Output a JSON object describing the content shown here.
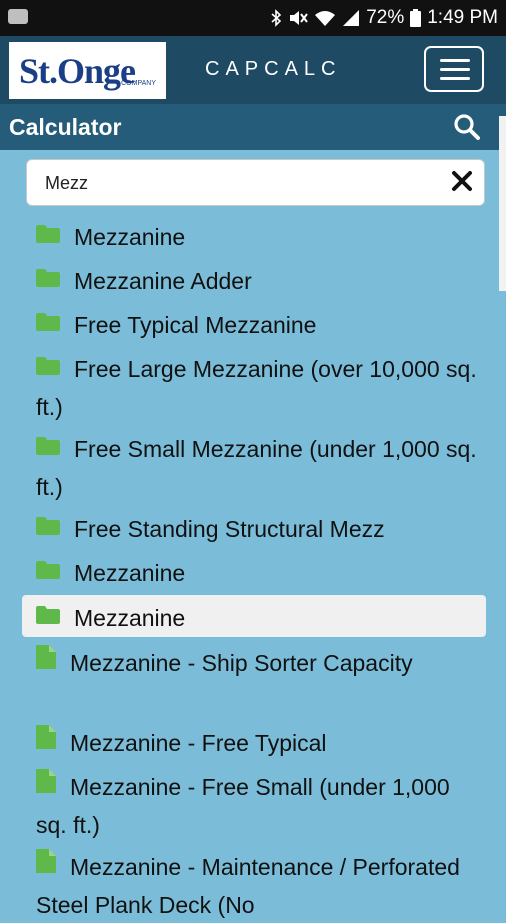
{
  "status_bar": {
    "battery": "72%",
    "time": "1:49 PM"
  },
  "header": {
    "logo_text": "St.Onge",
    "logo_small": "COMPANY",
    "title": "CAPCALC"
  },
  "subheader": {
    "title": "Calculator"
  },
  "search": {
    "value": "Mezz"
  },
  "results": [
    {
      "label": "Mezzanine",
      "icon": "folder-icon"
    },
    {
      "label": "Mezzanine Adder",
      "icon": "folder-icon"
    },
    {
      "label": "Free Typical Mezzanine",
      "icon": "folder-icon"
    },
    {
      "label": "Free Large Mezzanine (over 10,000 sq. ft.)",
      "icon": "folder-icon"
    },
    {
      "label": "Free Small Mezzanine (under 1,000 sq. ft.)",
      "icon": "folder-icon"
    },
    {
      "label": "Free Standing Structural Mezz",
      "icon": "folder-icon"
    },
    {
      "label": "Mezzanine",
      "icon": "folder-icon"
    },
    {
      "label": "Mezzanine",
      "icon": "folder-icon",
      "selected": true
    },
    {
      "label": "Mezzanine - Ship Sorter Capacity",
      "icon": "document-icon"
    },
    {
      "label": "Mezzanine - Free Typical",
      "icon": "document-icon"
    },
    {
      "label": "Mezzanine - Free Small (under 1,000 sq. ft.)",
      "icon": "document-icon"
    },
    {
      "label": "Mezzanine - Maintenance / Perforated Steel Plank Deck (No",
      "icon": "document-icon"
    }
  ],
  "colors": {
    "background": "#7bbdd8",
    "appbar": "#1e4b63",
    "subbar": "#245c79",
    "icon_green": "#5fb84a"
  }
}
